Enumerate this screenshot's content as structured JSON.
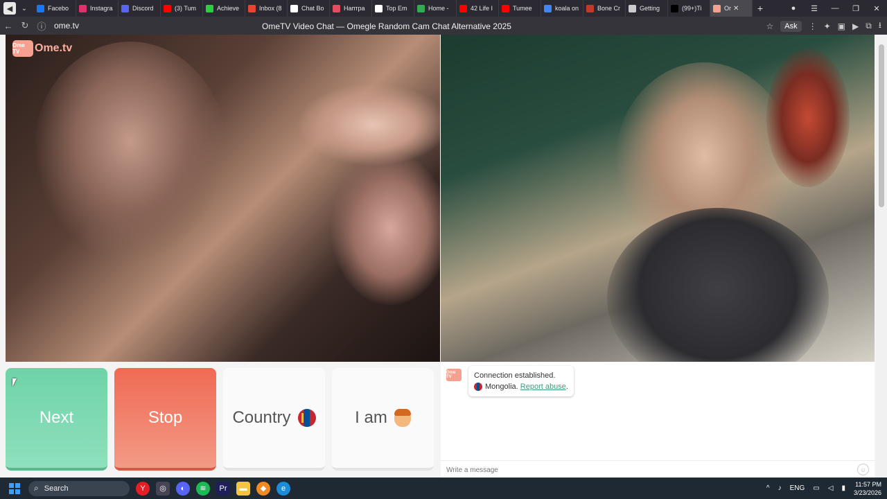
{
  "browser": {
    "tabs": [
      {
        "label": "Facebo",
        "color": "#1877f2"
      },
      {
        "label": "Instagra",
        "color": "#e1306c"
      },
      {
        "label": "Discord",
        "color": "#5865f2"
      },
      {
        "label": "(3) Tum",
        "color": "#ff0000"
      },
      {
        "label": "Achieve",
        "color": "#2ecc40"
      },
      {
        "label": "Inbox (8",
        "color": "#ea4335"
      },
      {
        "label": "Chat Bo",
        "color": "#ffffff"
      },
      {
        "label": "Наптра",
        "color": "#e44d5f"
      },
      {
        "label": "Top Em",
        "color": "#ffffff"
      },
      {
        "label": "Home -",
        "color": "#34a853"
      },
      {
        "label": "42 Life I",
        "color": "#ff0000"
      },
      {
        "label": "Tumee",
        "color": "#ff0000"
      },
      {
        "label": "koala on",
        "color": "#4285f4"
      },
      {
        "label": "Bone Cr",
        "color": "#c0392b"
      },
      {
        "label": "Getting",
        "color": "#cccccc"
      },
      {
        "label": "(99+)Ti",
        "color": "#000000"
      },
      {
        "label": "Or",
        "color": "#f6a08f"
      }
    ],
    "url": "ome.tv",
    "page_title": "OmeTV Video Chat — Omegle Random Cam Chat Alternative 2025",
    "ask_label": "Ask"
  },
  "logo": {
    "badge": "Ome TV",
    "text": "Ome.tv"
  },
  "controls": {
    "next": "Next",
    "stop": "Stop",
    "country": "Country",
    "iam": "I am"
  },
  "chat": {
    "avatar": "Ome TV",
    "message_line1": "Connection established.",
    "country": "Mongolia.",
    "report_link": "Report abuse",
    "report_suffix": ".",
    "input_placeholder": "Write a message"
  },
  "taskbar": {
    "search_label": "Search",
    "lang": "ENG",
    "time": "11:57 PM",
    "date": "3/23/2026"
  }
}
